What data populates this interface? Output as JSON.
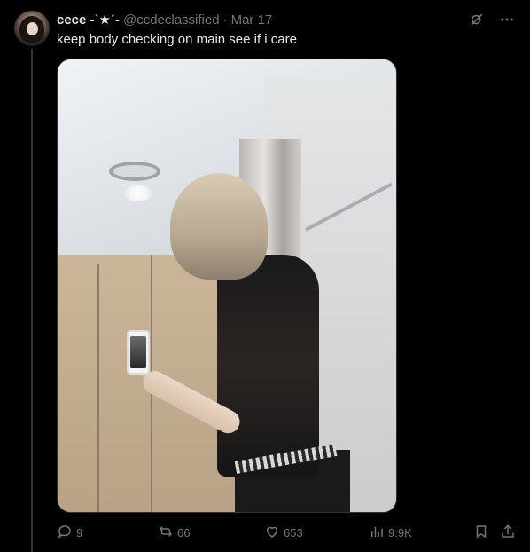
{
  "tweet": {
    "display_name": "cece -ˋ★ˊ-",
    "handle": "@ccdeclassified",
    "separator": "·",
    "date": "Mar 17",
    "text": "keep body checking on main see if i care"
  },
  "top_actions": [
    {
      "icon": "grok-icon"
    },
    {
      "icon": "more-icon"
    }
  ],
  "media": {
    "alt_icon": "photo"
  },
  "actions": {
    "replies": "9",
    "reposts": "66",
    "likes": "653",
    "views": "9.9K"
  },
  "colors": {
    "background": "#000000",
    "text": "#e7e9ea",
    "muted": "#71767b",
    "border": "#2f3336"
  }
}
